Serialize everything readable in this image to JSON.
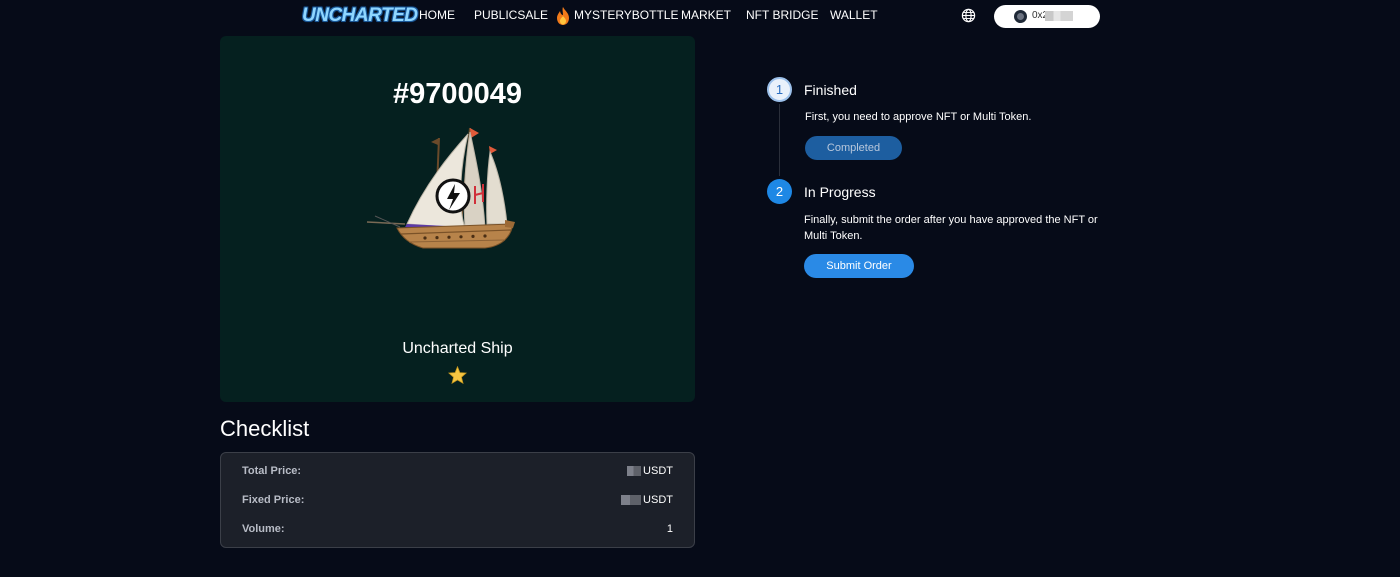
{
  "nav": {
    "logo": "UNCHARTED",
    "items": [
      "HOME",
      "PUBLICSALE",
      "MYSTERYBOTTLE",
      "MARKET",
      "NFT BRIDGE",
      "WALLET"
    ],
    "wallet_prefix": "0x2",
    "icons": {
      "language": "globe-icon",
      "hot": "fire-icon"
    }
  },
  "nft": {
    "id": "#9700049",
    "name": "Uncharted Ship",
    "rarity_stars": 1
  },
  "checklist": {
    "title": "Checklist",
    "rows": [
      {
        "label": "Total Price:",
        "value": "USDT"
      },
      {
        "label": "Fixed Price:",
        "value": "USDT"
      },
      {
        "label": "Volume:",
        "value": "1"
      }
    ]
  },
  "steps": [
    {
      "number": "1",
      "title": "Finished",
      "description": "First, you need to approve NFT or Multi Token.",
      "button": "Completed"
    },
    {
      "number": "2",
      "title": "In Progress",
      "description": "Finally, submit the order after you have approved the NFT or Multi Token.",
      "button": "Submit Order"
    }
  ],
  "colors": {
    "background": "#060b18",
    "card": "#05201f",
    "accent": "#2a8ae6",
    "completed": "#1d5ea0"
  }
}
